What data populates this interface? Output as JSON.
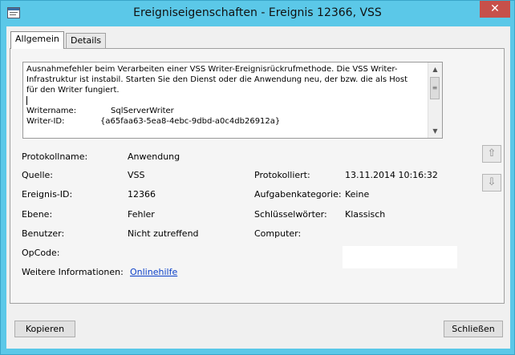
{
  "window": {
    "title": "Ereigniseigenschaften - Ereignis 12366, VSS",
    "close_glyph": "✕"
  },
  "tabs": [
    {
      "label": "Allgemein"
    },
    {
      "label": "Details"
    }
  ],
  "description": {
    "text": "Ausnahmefehler beim Verarbeiten einer VSS Writer-Ereignisrückrufmethode. Die VSS Writer-\nInfrastruktur ist instabil. Starten Sie den Dienst oder die Anwendung neu, der bzw. die als Host\nfür den Writer fungiert.",
    "writer_name_label": "Writername:",
    "writer_name_value": "SqlServerWriter",
    "writer_id_label": "Writer-ID:",
    "writer_id_value": "{a65faa63-5ea8-4ebc-9dbd-a0c4db26912a}"
  },
  "fields": {
    "protokollname": {
      "label": "Protokollname:",
      "value": "Anwendung"
    },
    "quelle": {
      "label": "Quelle:",
      "value": "VSS"
    },
    "ereignis_id": {
      "label": "Ereignis-ID:",
      "value": "12366"
    },
    "ebene": {
      "label": "Ebene:",
      "value": "Fehler"
    },
    "benutzer": {
      "label": "Benutzer:",
      "value": "Nicht zutreffend"
    },
    "opcode": {
      "label": "OpCode:",
      "value": ""
    },
    "weitere_info": {
      "label": "Weitere Informationen:",
      "link": "Onlinehilfe"
    },
    "protokolliert": {
      "label": "Protokolliert:",
      "value": "13.11.2014 10:16:32"
    },
    "aufgabenkategorie": {
      "label": "Aufgabenkategorie:",
      "value": "Keine"
    },
    "schluesselwoerter": {
      "label": "Schlüsselwörter:",
      "value": "Klassisch"
    },
    "computer": {
      "label": "Computer:",
      "value": ""
    }
  },
  "nav": {
    "up_icon": "⇧",
    "down_icon": "⇩"
  },
  "buttons": {
    "copy": "Kopieren",
    "close": "Schließen"
  }
}
